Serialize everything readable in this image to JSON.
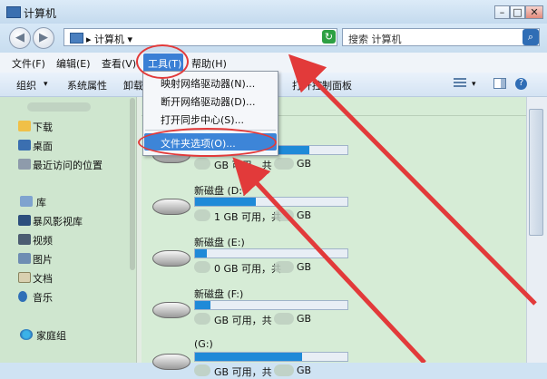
{
  "window": {
    "title": "计算机"
  },
  "address": {
    "crumb": "计算机",
    "search_placeholder": "搜索 计算机"
  },
  "menubar": {
    "items": [
      "文件(F)",
      "编辑(E)",
      "查看(V)",
      "工具(T)",
      "帮助(H)"
    ]
  },
  "toolbar": {
    "items": [
      "组织",
      "系统属性",
      "卸载",
      "打开控制面板"
    ]
  },
  "nav": {
    "favorites": [
      "下载",
      "桌面",
      "最近访问的位置"
    ],
    "library_header": "库",
    "libraries": [
      "暴风影视库",
      "视频",
      "图片",
      "文档",
      "音乐"
    ],
    "homegroup": "家庭组"
  },
  "tools_menu": {
    "items": [
      "映射网络驱动器(N)...",
      "断开网络驱动器(D)...",
      "打开同步中心(S)...",
      "文件夹选项(O)..."
    ],
    "selected": "文件夹选项(O)..."
  },
  "drives": [
    {
      "name": "",
      "stat": "GB 可用，共",
      "unit": "GB",
      "used": 0.75
    },
    {
      "name": "新磁盘 (D:)",
      "stat": "1 GB 可用，共",
      "unit": "GB",
      "used": 0.4
    },
    {
      "name": "新磁盘 (E:)",
      "stat": "0 GB 可用，共",
      "unit": "GB",
      "used": 0.08
    },
    {
      "name": "新磁盘 (F:)",
      "stat": "GB 可用，共",
      "unit": "GB",
      "used": 0.1
    },
    {
      "name": "(G:)",
      "stat": "GB 可用，共",
      "unit": "GB",
      "used": 0.7
    }
  ],
  "colors": {
    "annotation": "#e23a3a",
    "highlight": "#3d85d8",
    "drive_fill": "#1f8ad8"
  },
  "icons": [
    "computer-icon",
    "back-arrow-icon",
    "forward-arrow-icon",
    "refresh-icon",
    "search-icon",
    "view-icon",
    "preview-pane-icon",
    "help-icon",
    "drive-icon"
  ]
}
